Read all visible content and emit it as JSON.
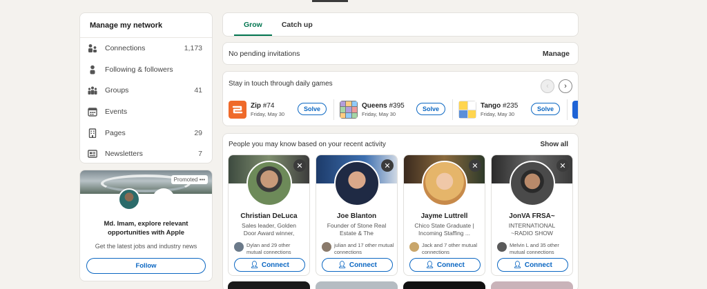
{
  "network": {
    "title": "Manage my network",
    "items": [
      {
        "label": "Connections",
        "count": "1,173",
        "icon": "connections-icon"
      },
      {
        "label": "Following & followers",
        "count": "",
        "icon": "person-icon"
      },
      {
        "label": "Groups",
        "count": "41",
        "icon": "groups-icon"
      },
      {
        "label": "Events",
        "count": "",
        "icon": "calendar-icon"
      },
      {
        "label": "Pages",
        "count": "29",
        "icon": "building-icon"
      },
      {
        "label": "Newsletters",
        "count": "7",
        "icon": "newspaper-icon"
      }
    ]
  },
  "ad": {
    "promoted": "Promoted",
    "more": "•••",
    "logo": "",
    "headline": "Md. Imam, explore relevant opportunities with Apple",
    "sub": "Get the latest jobs and industry news",
    "follow": "Follow"
  },
  "tabs": [
    "Grow",
    "Catch up"
  ],
  "invitations": {
    "text": "No pending invitations",
    "manage": "Manage"
  },
  "games": {
    "title": "Stay in touch through daily games",
    "prev": "‹",
    "next": "›",
    "items": [
      {
        "name": "Zip",
        "number": "#74",
        "date": "Friday, May 30",
        "solve": "Solve"
      },
      {
        "name": "Queens",
        "number": "#395",
        "date": "Friday, May 30",
        "solve": "Solve"
      },
      {
        "name": "Tango",
        "number": "#235",
        "date": "Friday, May 30",
        "solve": "Solve"
      }
    ]
  },
  "pymk": {
    "title": "People you may know based on your recent activity",
    "show_all": "Show all",
    "close": "✕",
    "connect": "Connect",
    "people": [
      {
        "name": "Christian DeLuca",
        "headline": "Sales leader, Golden Door Award winner, running a...",
        "mutual": "Dylan and 29 other mutual connections"
      },
      {
        "name": "Joe Blanton",
        "headline": "Founder of Stone Real Estate & The Restaurant...",
        "mutual": "julian and 17 other mutual connections"
      },
      {
        "name": "Jayme Luttrell",
        "headline": "Chico State Graduate | Incoming Staffing ...",
        "mutual": "Jack and 7 other mutual connections"
      },
      {
        "name": "JonVA FRSA~",
        "headline": "INTERNATIONAL ~RADIO SHOW HOST~PRODUCE...",
        "mutual": "Melvin L and 35 other mutual connections"
      }
    ]
  }
}
